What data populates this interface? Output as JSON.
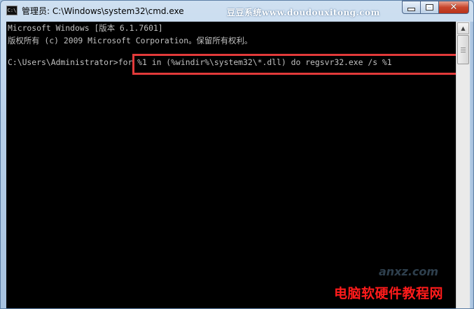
{
  "window": {
    "title": "管理员: C:\\Windows\\system32\\cmd.exe",
    "icon_text": "C:\\",
    "watermark": "豆豆系统www.doudouxitong.com",
    "controls": {
      "close_glyph": "✕"
    }
  },
  "console": {
    "line1": "Microsoft Windows [版本 6.1.7601]",
    "line2": "版权所有 (c) 2009 Microsoft Corporation。保留所有权利。",
    "prompt": "C:\\Users\\Administrator>",
    "command": "for %1 in (%windir%\\system32\\*.dll) do regsvr32.exe /s %1",
    "highlight_color": "#e23a3a"
  },
  "scrollbar": {
    "up_arrow": "▲"
  },
  "footer_watermark": "电脑软硬件教程网",
  "corner_watermark": "anxz.com",
  "colors": {
    "console_bg": "#000000",
    "console_text": "#c0c0c0",
    "watermark_red": "#ff1b1b"
  }
}
